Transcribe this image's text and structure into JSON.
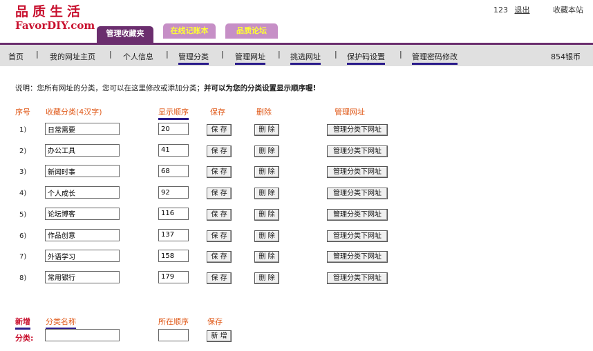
{
  "logo": {
    "cn": "品质生活",
    "en": "FavorDIY.com"
  },
  "top": {
    "user": "123",
    "logout": "退出",
    "favorite": "收藏本站"
  },
  "tabs": [
    {
      "label": "管理收藏夹",
      "active": true
    },
    {
      "label": "在线记账本",
      "active": false
    },
    {
      "label": "品质论坛",
      "active": false
    }
  ],
  "nav": [
    {
      "label": "首页"
    },
    {
      "label": "我的网址主页"
    },
    {
      "label": "个人信息"
    },
    {
      "label": "管理分类"
    },
    {
      "label": "管理网址"
    },
    {
      "label": "挑选网址"
    },
    {
      "label": "保护码设置"
    },
    {
      "label": "管理密码修改"
    }
  ],
  "coins": "854银币",
  "notice": {
    "text": "说明：您所有网址的分类，您可以在这里修改或添加分类；",
    "bold": "并可以为您的分类设置显示顺序喔!"
  },
  "headers": {
    "index": "序号",
    "category": "收藏分类(4汉字)",
    "order": "显示顺序",
    "save": "保存",
    "delete": "删除",
    "manage": "管理网址"
  },
  "buttons": {
    "save": "保 存",
    "delete": "删 除",
    "manage": "管理分类下网址",
    "add": "新 增"
  },
  "rows": [
    {
      "index": "1)",
      "name": "日常需要",
      "order": "20"
    },
    {
      "index": "2)",
      "name": "办公工具",
      "order": "41"
    },
    {
      "index": "3)",
      "name": "新闻时事",
      "order": "68"
    },
    {
      "index": "4)",
      "name": "个人成长",
      "order": "92"
    },
    {
      "index": "5)",
      "name": "论坛博客",
      "order": "116"
    },
    {
      "index": "6)",
      "name": "作品创意",
      "order": "137"
    },
    {
      "index": "7)",
      "name": "外语学习",
      "order": "158"
    },
    {
      "index": "8)",
      "name": "常用银行",
      "order": "179"
    }
  ],
  "new_section": {
    "add_label": "新增",
    "name_label": "分类名称",
    "order_label": "所在顺序",
    "save_label": "保存",
    "category_label": "分类:",
    "name_value": "",
    "order_value": ""
  }
}
